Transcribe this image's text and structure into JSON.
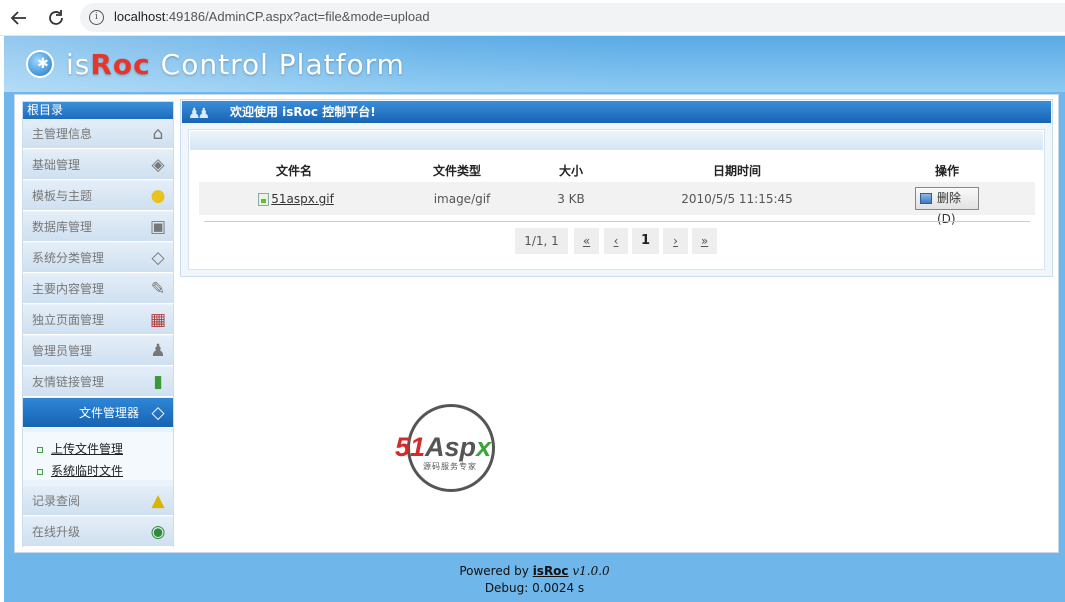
{
  "browser": {
    "url_host": "localhost",
    "url_rest": ":49186/AdminCP.aspx?act=file&mode=upload"
  },
  "header": {
    "logo_is": "is",
    "logo_roc": "Roc",
    "logo_rest": " Control Platform"
  },
  "sidebar": {
    "title": "根目录",
    "items": [
      {
        "label": "主管理信息",
        "icon": "house-icon"
      },
      {
        "label": "基础管理",
        "icon": "cube-icon"
      },
      {
        "label": "模板与主题",
        "icon": "lightbulb-icon"
      },
      {
        "label": "数据库管理",
        "icon": "database-icon"
      },
      {
        "label": "系统分类管理",
        "icon": "diamond-icon"
      },
      {
        "label": "主要内容管理",
        "icon": "book-icon"
      },
      {
        "label": "独立页面管理",
        "icon": "books-icon"
      },
      {
        "label": "管理员管理",
        "icon": "users-icon"
      },
      {
        "label": "友情链接管理",
        "icon": "bottle-icon"
      },
      {
        "label": "文件管理器",
        "icon": "folder-icon"
      },
      {
        "label": "记录查阅",
        "icon": "warning-icon"
      },
      {
        "label": "在线升级",
        "icon": "globe-icon"
      }
    ],
    "sub_items": [
      "上传文件管理",
      "系统临时文件"
    ]
  },
  "content": {
    "title": "欢迎使用 isRoc 控制平台!",
    "columns": [
      "文件名",
      "文件类型",
      "大小",
      "日期时间",
      "操作"
    ],
    "rows": [
      {
        "name": "51aspx.gif",
        "type": "image/gif",
        "size": "3 KB",
        "datetime": "2010/5/5 11:15:45",
        "action": "删除(D)"
      }
    ],
    "pager": {
      "info": "1/1, 1",
      "first": "«",
      "prev": "‹",
      "current": "1",
      "next": "›",
      "last": "»"
    }
  },
  "watermark": {
    "text_51": "51",
    "text_aspx": "Asp",
    "text_x": "x",
    "sub": "源码服务专家"
  },
  "footer": {
    "powered_prefix": "Powered by ",
    "brand": "isRoc",
    "version": "v1.0.0",
    "debug": "Debug: 0.0024 s"
  }
}
